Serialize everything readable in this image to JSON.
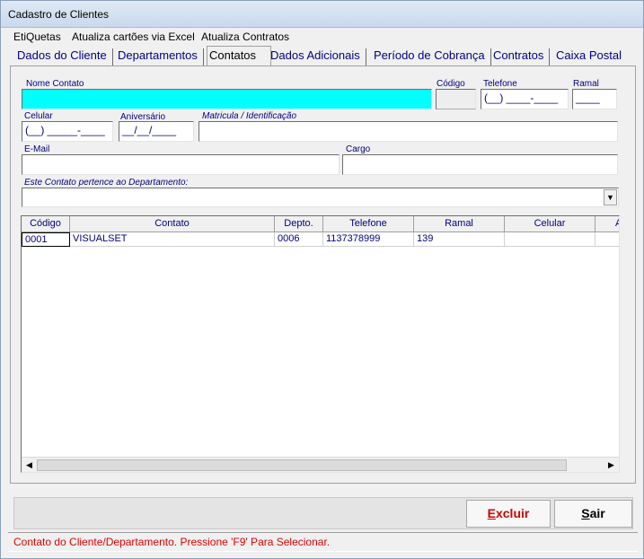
{
  "window": {
    "title": "Cadastro de Clientes"
  },
  "menu": [
    "EtiQuetas",
    "Atualiza cartões via Excel",
    "Atualiza Contratos"
  ],
  "tabs": [
    "Dados do Cliente",
    "Departamentos",
    "Contatos",
    "Dados Adicionais",
    "Período de Cobrança",
    "Contratos",
    "Caixa Postal"
  ],
  "active_tab": "Contatos",
  "form": {
    "nome_contato": {
      "label": "Nome Contato",
      "value": ""
    },
    "codigo": {
      "label": "Código",
      "value": ""
    },
    "telefone": {
      "label": "Telefone",
      "value": "(__) ____-____"
    },
    "ramal": {
      "label": "Ramal",
      "value": "____"
    },
    "celular": {
      "label": "Celular",
      "value": "(__) _____-____"
    },
    "aniversario": {
      "label": "Aniversário",
      "value": "__/__/____"
    },
    "matricula": {
      "label": "Matricula / Identificação",
      "value": ""
    },
    "email": {
      "label": "E-Mail",
      "value": ""
    },
    "cargo": {
      "label": "Cargo",
      "value": ""
    },
    "departamento": {
      "label": "Este Contato pertence ao Departamento:",
      "value": ""
    }
  },
  "grid": {
    "columns": [
      "Código",
      "Contato",
      "Depto.",
      "Telefone",
      "Ramal",
      "Celular",
      "A"
    ],
    "rows": [
      [
        "0001",
        "VISUALSET",
        "0006",
        "1137378999",
        "139",
        "",
        ""
      ]
    ]
  },
  "buttons": {
    "excluir": {
      "accel": "E",
      "rest": "xcluir",
      "color": "#cc0000"
    },
    "sair": {
      "accel": "S",
      "rest": "air",
      "color": "#000000"
    }
  },
  "status": "Contato do Cliente/Departamento. Pressione 'F9' Para Selecionar."
}
